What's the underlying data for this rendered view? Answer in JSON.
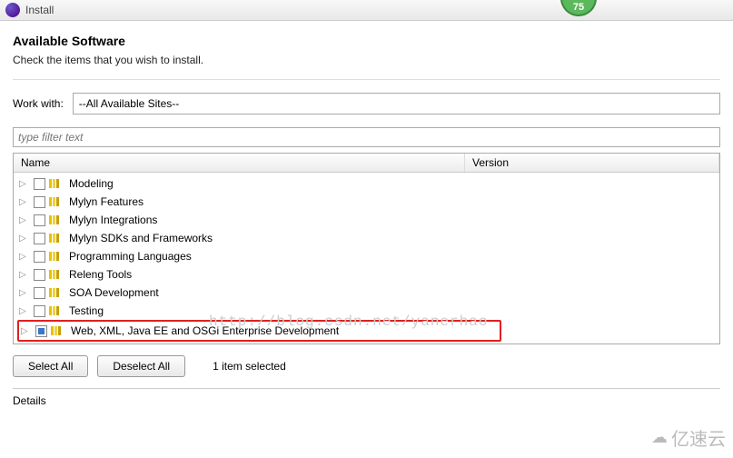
{
  "window": {
    "title": "Install",
    "progress": "75"
  },
  "header": {
    "title": "Available Software",
    "subtitle": "Check the items that you wish to install."
  },
  "workwith": {
    "label": "Work with:",
    "value": "--All Available Sites--"
  },
  "filter": {
    "placeholder": "type filter text"
  },
  "columns": {
    "name": "Name",
    "version": "Version"
  },
  "items": [
    {
      "label": "Modeling",
      "checked": false
    },
    {
      "label": "Mylyn Features",
      "checked": false
    },
    {
      "label": "Mylyn Integrations",
      "checked": false
    },
    {
      "label": "Mylyn SDKs and Frameworks",
      "checked": false
    },
    {
      "label": "Programming Languages",
      "checked": false
    },
    {
      "label": "Releng Tools",
      "checked": false
    },
    {
      "label": "SOA Development",
      "checked": false
    },
    {
      "label": "Testing",
      "checked": false
    },
    {
      "label": "Web, XML, Java EE and OSGi Enterprise Development",
      "checked": true
    }
  ],
  "actions": {
    "selectAll": "Select All",
    "deselectAll": "Deselect All",
    "selectedCount": "1 item selected"
  },
  "details": {
    "label": "Details"
  },
  "watermark": "http://blog.csdn.net/yanerhao",
  "logo": "亿速云"
}
